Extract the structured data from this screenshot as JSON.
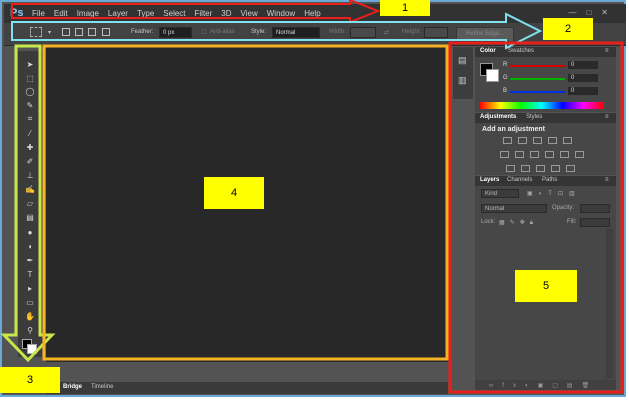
{
  "app": {
    "logo": "Ps"
  },
  "menubar": {
    "items": [
      "File",
      "Edit",
      "Image",
      "Layer",
      "Type",
      "Select",
      "Filter",
      "3D",
      "View",
      "Window",
      "Help"
    ]
  },
  "window_controls": [
    "—",
    "□",
    "✕"
  ],
  "options": {
    "feather_label": "Feather:",
    "feather_value": "0 px",
    "antialias_label": "Anti-alias",
    "style_label": "Style:",
    "style_value": "Normal",
    "width_label": "Width:",
    "height_label": "Height:",
    "refine_label": "Refine Edge..."
  },
  "bottom_tabs": [
    "Bridge",
    "Timeline"
  ],
  "color_panel": {
    "tabs": [
      "Color",
      "Swatches"
    ],
    "sliders": [
      {
        "label": "R",
        "value": "0",
        "color": "#d40000"
      },
      {
        "label": "G",
        "value": "0",
        "color": "#00b000"
      },
      {
        "label": "B",
        "value": "0",
        "color": "#0030e0"
      }
    ]
  },
  "adjustments_panel": {
    "tabs": [
      "Adjustments",
      "Styles"
    ],
    "title": "Add an adjustment"
  },
  "layers_panel": {
    "tabs": [
      "Layers",
      "Channels",
      "Paths"
    ],
    "kind_label": "Kind",
    "blend_mode": "Normal",
    "opacity_label": "Opacity:",
    "lock_label": "Lock:",
    "fill_label": "Fill:"
  },
  "annotations": [
    {
      "number": "1",
      "color": "#e8201a"
    },
    {
      "number": "2",
      "color": "#80e0ee"
    },
    {
      "number": "3",
      "color": "#c6e84a"
    },
    {
      "number": "4",
      "color": "#f5b223"
    },
    {
      "number": "5",
      "color": "#e8201a"
    }
  ]
}
